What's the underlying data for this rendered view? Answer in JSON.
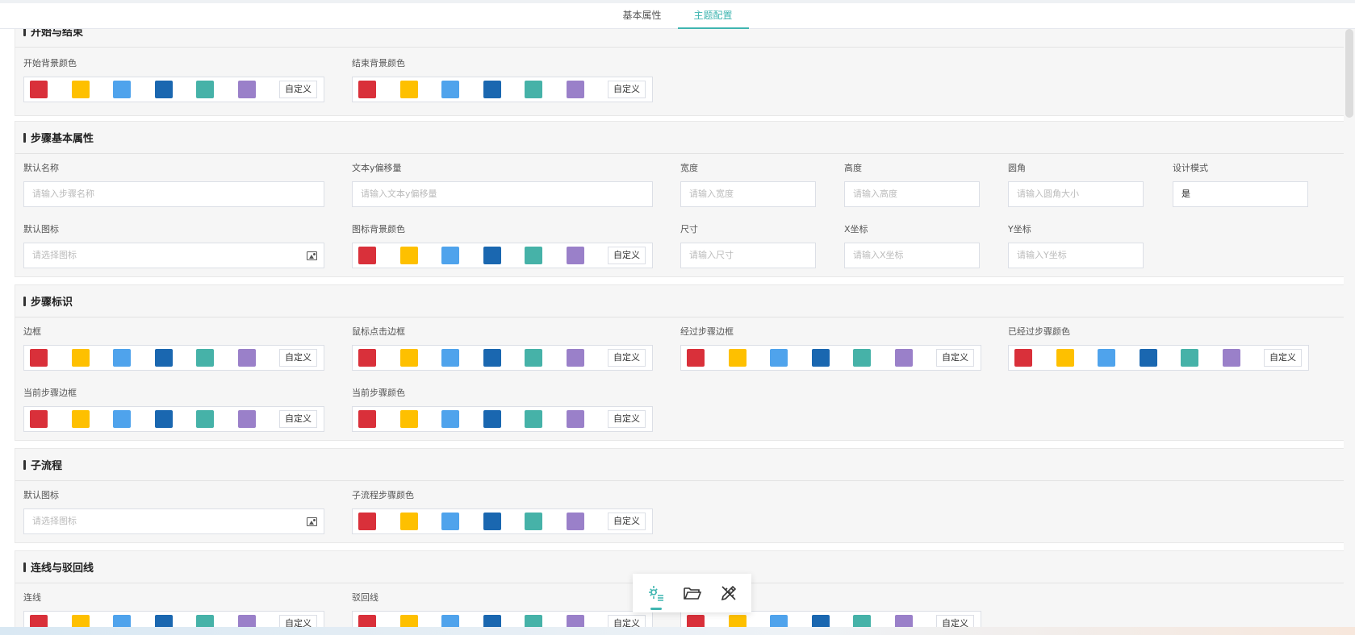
{
  "tabs": [
    "基本属性",
    "主题配置"
  ],
  "colors": [
    "#d9303a",
    "#fec000",
    "#4fa3ec",
    "#1a67b0",
    "#46b2a8",
    "#9a80c9"
  ],
  "swatch_names": [
    "red",
    "yellow",
    "light-blue",
    "dark-blue",
    "teal",
    "purple"
  ],
  "custom_label": "自定义",
  "sections": {
    "start_end": {
      "title": "开始与结束",
      "start_bg": "开始背景颜色",
      "end_bg": "结束背景颜色"
    },
    "step_basic": {
      "title": "步骤基本属性",
      "default_name": "默认名称",
      "default_name_ph": "请输入步骤名称",
      "text_y_offset": "文本y偏移量",
      "text_y_offset_ph": "请输入文本y偏移量",
      "width": "宽度",
      "width_ph": "请输入宽度",
      "height": "高度",
      "height_ph": "请输入高度",
      "radius": "圆角",
      "radius_ph": "请输入圆角大小",
      "design_mode": "设计模式",
      "design_mode_value": "是",
      "default_icon": "默认图标",
      "default_icon_ph": "请选择图标",
      "icon_bg": "图标背景颜色",
      "size": "尺寸",
      "size_ph": "请输入尺寸",
      "x_coord": "X坐标",
      "x_coord_ph": "请输入X坐标",
      "y_coord": "Y坐标",
      "y_coord_ph": "请输入Y坐标"
    },
    "step_mark": {
      "title": "步骤标识",
      "border": "边框",
      "click_border": "鼠标点击边框",
      "passed_border": "经过步骤边框",
      "passed_color": "已经过步骤颜色",
      "current_border": "当前步骤边框",
      "current_color": "当前步骤颜色"
    },
    "subflow": {
      "title": "子流程",
      "default_icon": "默认图标",
      "default_icon_ph": "请选择图标",
      "step_color": "子流程步骤颜色"
    },
    "lines": {
      "title": "连线与驳回线",
      "line": "连线",
      "reject_line": "驳回线"
    }
  }
}
